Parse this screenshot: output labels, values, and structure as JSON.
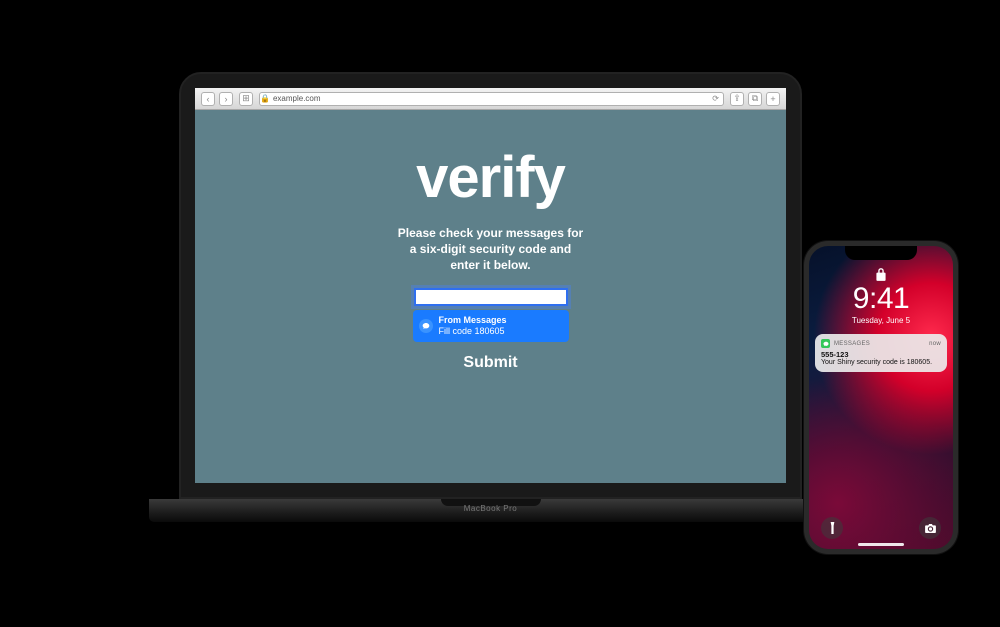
{
  "laptop": {
    "brand": "MacBook Pro",
    "safari": {
      "url_host": "example.com",
      "back_icon": "‹",
      "forward_icon": "›",
      "sidebar_icon": "⊞",
      "lock_icon": "🔒",
      "reload_icon": "⟳",
      "share_icon": "⇪",
      "tabs_icon": "⧉",
      "newtab_icon": "+"
    },
    "page": {
      "title": "verify",
      "subtitle_line1": "Please check your messages for",
      "subtitle_line2": "a six-digit security code and",
      "subtitle_line3": "enter it below.",
      "code_value": "",
      "autofill_source": "From Messages",
      "autofill_action": "Fill code 180605",
      "submit_label": "Submit"
    }
  },
  "phone": {
    "carrier_left": "",
    "carrier_right": "",
    "time": "9:41",
    "date": "Tuesday, June 5",
    "notification": {
      "app": "MESSAGES",
      "when": "now",
      "title": "555-123",
      "body": "Your Shiny security code is 180605."
    }
  }
}
